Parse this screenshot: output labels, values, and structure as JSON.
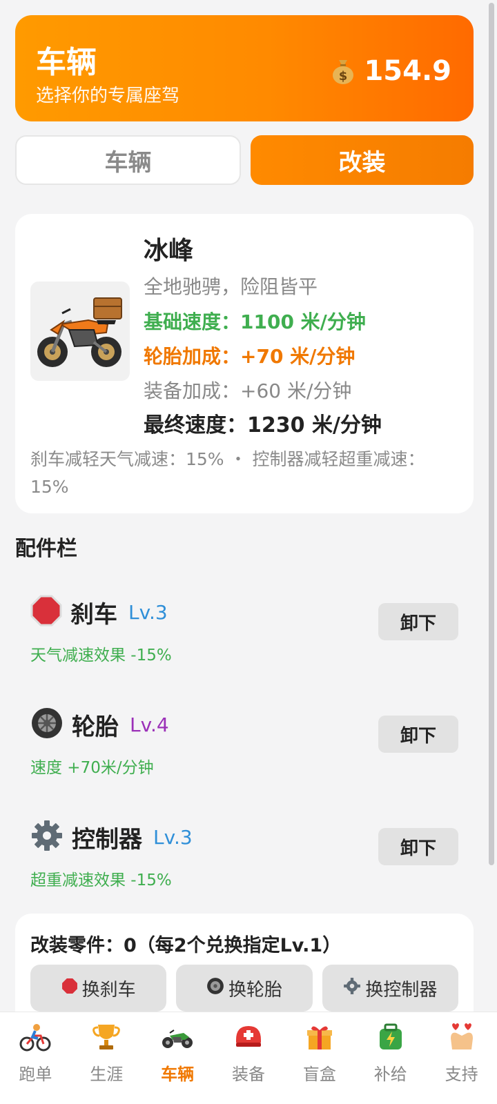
{
  "header": {
    "title": "车辆",
    "subtitle": "选择你的专属座驾",
    "coins": "154.9",
    "coin_icon": "money-bag-icon"
  },
  "tabs": [
    {
      "label": "车辆",
      "active": false
    },
    {
      "label": "改装",
      "active": true
    }
  ],
  "vehicle": {
    "name": "冰峰",
    "description": "全地驰骋，险阻皆平",
    "base_speed": "基础速度：1100 米/分钟",
    "tire_bonus": "轮胎加成：+70 米/分钟",
    "equip_bonus": "装备加成：+60 米/分钟",
    "final_speed": "最终速度：1230 米/分钟",
    "note": "刹车减轻天气减速：15% ・ 控制器减轻超重减速：15%"
  },
  "parts_section": {
    "title": "配件栏",
    "items": [
      {
        "name": "刹车",
        "level": "Lv.3",
        "level_color": "#2f8fd8",
        "effect": "天气减速效果 -15%",
        "button": "卸下",
        "icon": "stop-sign-icon"
      },
      {
        "name": "轮胎",
        "level": "Lv.4",
        "level_color": "#9b30b8",
        "effect": "速度 +70米/分钟",
        "button": "卸下",
        "icon": "tire-icon"
      },
      {
        "name": "控制器",
        "level": "Lv.3",
        "level_color": "#2f8fd8",
        "effect": "超重减速效果 -15%",
        "button": "卸下",
        "icon": "gear-icon"
      }
    ]
  },
  "mod_parts": {
    "title": "改装零件：0（每2个兑换指定Lv.1）",
    "buttons": [
      {
        "label": "换刹车",
        "icon": "stop-sign-icon"
      },
      {
        "label": "换轮胎",
        "icon": "tire-icon"
      },
      {
        "label": "换控制器",
        "icon": "gear-icon"
      }
    ]
  },
  "bottom_nav": [
    {
      "label": "跑单",
      "icon": "cyclist-icon",
      "active": false
    },
    {
      "label": "生涯",
      "icon": "trophy-icon",
      "active": false
    },
    {
      "label": "车辆",
      "icon": "motorcycle-icon",
      "active": true
    },
    {
      "label": "装备",
      "icon": "helmet-icon",
      "active": false
    },
    {
      "label": "盲盒",
      "icon": "gift-box-icon",
      "active": false
    },
    {
      "label": "补给",
      "icon": "supply-kit-icon",
      "active": false
    },
    {
      "label": "支持",
      "icon": "finger-heart-icon",
      "active": false
    }
  ],
  "colors": {
    "accent": "#ff8a00",
    "green": "#3fae4f",
    "orange": "#f07800"
  }
}
